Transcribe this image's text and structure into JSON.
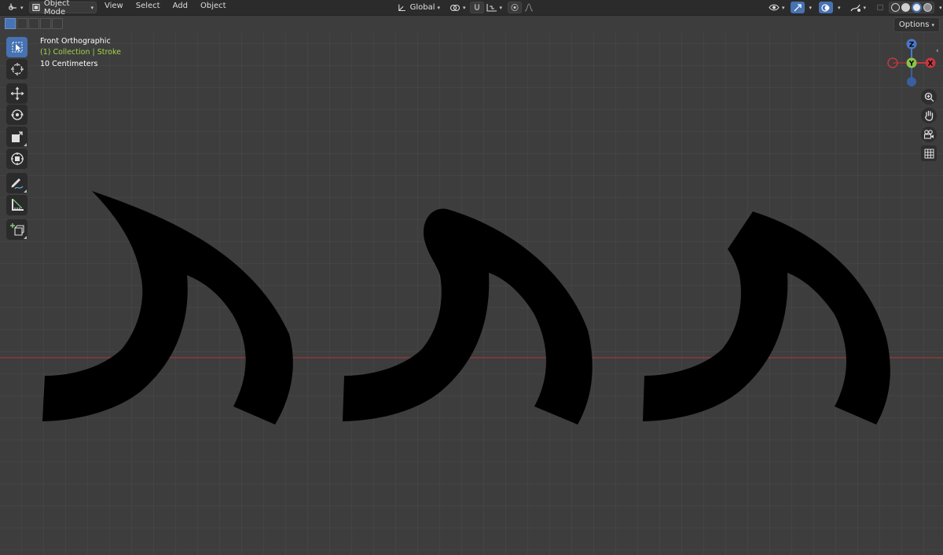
{
  "header": {
    "mode_label": "Object Mode",
    "menus": [
      "View",
      "Select",
      "Add",
      "Object"
    ],
    "orientation_label": "Global"
  },
  "options_label": "Options",
  "viewport": {
    "view_title": "Front Orthographic",
    "collection_text": "(1) Collection | Stroke",
    "grid_units": "10 Centimeters"
  },
  "gizmo": {
    "z_label": "Z",
    "y_label": "Y",
    "x_label": "X"
  },
  "colors": {
    "viewport_bg": "#3d3d3d",
    "grid_line": "#4a4a4a",
    "x_axis": "#b0383b",
    "accent": "#4772b3",
    "collection_text": "#a2d34a",
    "stroke": "#000000"
  },
  "tools": [
    "select-box",
    "cursor",
    "move",
    "rotate",
    "scale",
    "transform",
    "annotate",
    "measure",
    "add-cube"
  ],
  "strokes": [
    "stroke-sharp-tip",
    "stroke-round-cap",
    "stroke-flat-cap"
  ]
}
